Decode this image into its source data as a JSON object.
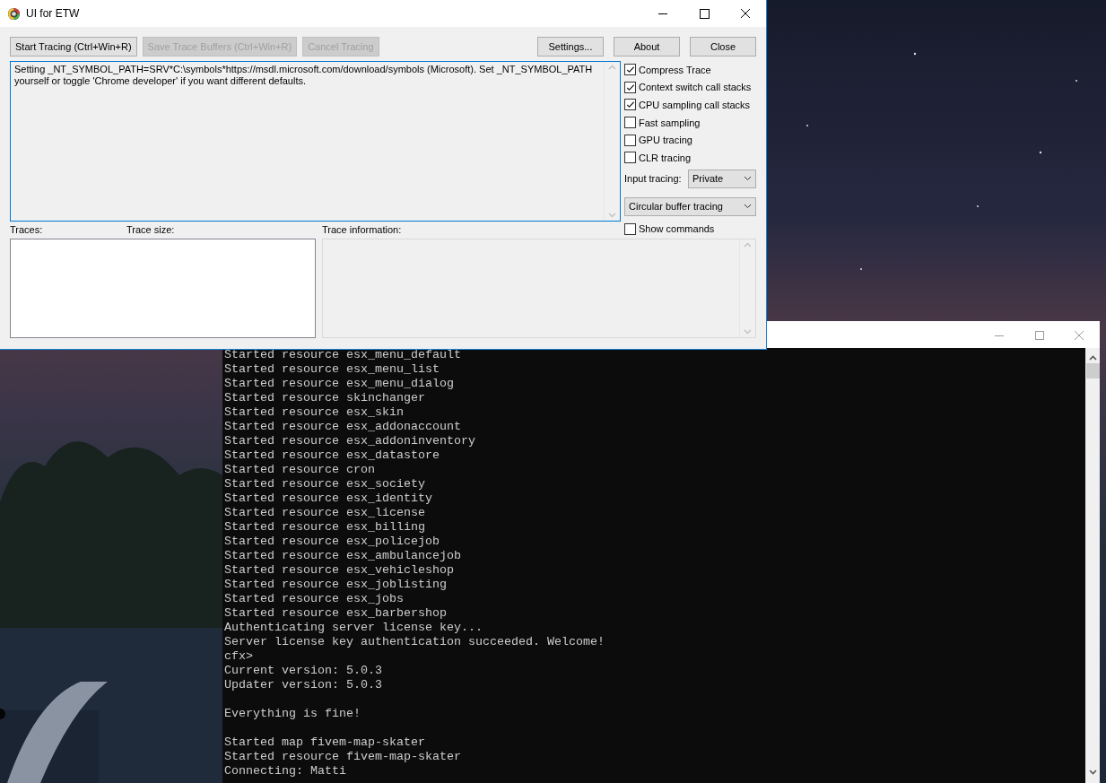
{
  "etw_window": {
    "title": "UI for ETW",
    "buttons": [
      {
        "label": "Start Tracing (Ctrl+Win+R)",
        "disabled": false
      },
      {
        "label": "Save Trace Buffers (Ctrl+Win+R)",
        "disabled": true
      },
      {
        "label": "Cancel Tracing",
        "disabled": true
      }
    ],
    "right_buttons": [
      {
        "label": "Settings..."
      },
      {
        "label": "About"
      },
      {
        "label": "Close"
      }
    ],
    "output_text": "Setting _NT_SYMBOL_PATH=SRV*C:\\symbols*https://msdl.microsoft.com/download/symbols (Microsoft). Set _NT_SYMBOL_PATH yourself or toggle 'Chrome developer' if you want different defaults.",
    "options": [
      {
        "label": "Compress Trace",
        "checked": true
      },
      {
        "label": "Context switch call stacks",
        "checked": true
      },
      {
        "label": "CPU sampling call stacks",
        "checked": true
      },
      {
        "label": "Fast sampling",
        "checked": false
      },
      {
        "label": "GPU tracing",
        "checked": false
      },
      {
        "label": "CLR tracing",
        "checked": false
      }
    ],
    "input_tracing": {
      "label": "Input tracing:",
      "value": "Private"
    },
    "buffer_mode": {
      "value": "Circular buffer tracing"
    },
    "show_commands": {
      "label": "Show commands",
      "checked": false
    },
    "traces_label": "Traces:",
    "trace_size_label": "Trace size:",
    "trace_info_label": "Trace information:"
  },
  "console_window": {
    "blocks": [
      [
        "Started resource esx_menu_default",
        "Started resource esx_menu_list",
        "Started resource esx_menu_dialog",
        "Started resource skinchanger",
        "Started resource esx_skin",
        "Started resource esx_addonaccount",
        "Started resource esx_addoninventory",
        "Started resource esx_datastore",
        "Started resource cron",
        "Started resource esx_society",
        "Started resource esx_identity",
        "Started resource esx_license",
        "Started resource esx_billing",
        "Started resource esx_policejob",
        "Started resource esx_ambulancejob",
        "Started resource esx_vehicleshop",
        "Started resource esx_joblisting",
        "Started resource esx_jobs",
        "Started resource esx_barbershop",
        "Authenticating server license key...",
        "Server license key authentication succeeded. Welcome!",
        "cfx>",
        "Current version: 5.0.3",
        "Updater version: 5.0.3"
      ],
      [
        "Everything is fine!"
      ],
      [
        "Started map fivem-map-skater",
        "Started resource fivem-map-skater",
        "Connecting: Matti"
      ]
    ]
  }
}
